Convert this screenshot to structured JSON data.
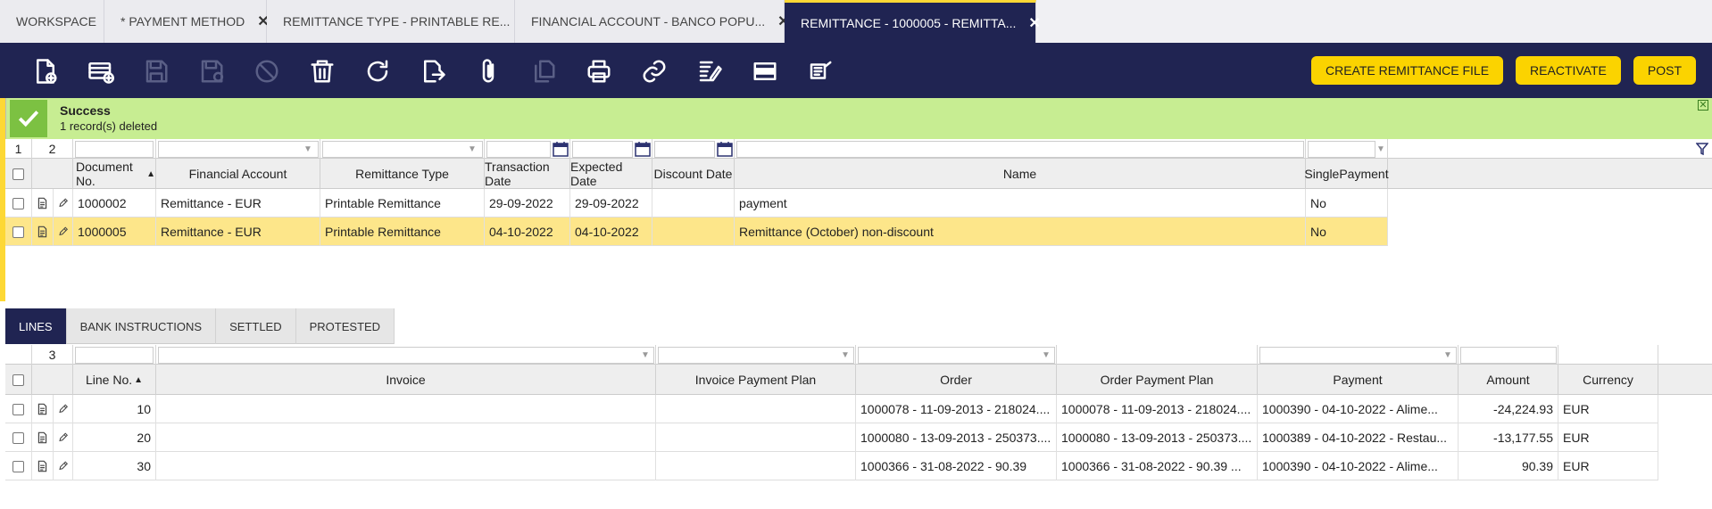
{
  "tabs": [
    {
      "label": "WORKSPACE",
      "closable": false
    },
    {
      "label": "* PAYMENT METHOD",
      "closable": true
    },
    {
      "label": "REMITTANCE TYPE - PRINTABLE RE...",
      "closable": true
    },
    {
      "label": "FINANCIAL ACCOUNT - BANCO POPU...",
      "closable": true
    },
    {
      "label": "REMITTANCE - 1000005 - REMITTA...",
      "closable": true
    }
  ],
  "toolbar": {
    "icons": [
      "new-document-icon",
      "new-row-icon",
      "save-icon",
      "save-close-icon",
      "undo-icon",
      "delete-icon",
      "refresh-icon",
      "export-icon",
      "attachment-icon",
      "copy-icon",
      "print-icon",
      "link-icon",
      "audit-icon",
      "toggle-view-icon",
      "notes-icon"
    ],
    "create_file": "CREATE REMITTANCE FILE",
    "reactivate": "REACTIVATE",
    "post": "POST"
  },
  "message": {
    "title": "Success",
    "text": "1 record(s) deleted"
  },
  "header_grid": {
    "selected_count": "1",
    "total_count": "2",
    "columns": [
      "Document No.",
      "Financial Account",
      "Remittance Type",
      "Transaction Date",
      "Expected Date",
      "Discount Date",
      "Name",
      "SinglePayment"
    ],
    "rows": [
      {
        "doc": "1000002",
        "account": "Remittance - EUR",
        "type": "Printable Remittance",
        "tdate": "29-09-2022",
        "edate": "29-09-2022",
        "ddate": "",
        "name": "payment",
        "single": "No"
      },
      {
        "doc": "1000005",
        "account": "Remittance - EUR",
        "type": "Printable Remittance",
        "tdate": "04-10-2022",
        "edate": "04-10-2022",
        "ddate": "",
        "name": "Remittance (October) non-discount",
        "single": "No"
      }
    ]
  },
  "subtabs": [
    "LINES",
    "BANK INSTRUCTIONS",
    "SETTLED",
    "PROTESTED"
  ],
  "lines_grid": {
    "count": "3",
    "columns": [
      "Line No.",
      "Invoice",
      "Invoice Payment Plan",
      "Order",
      "Order Payment Plan",
      "Payment",
      "Amount",
      "Currency"
    ],
    "rows": [
      {
        "line": "10",
        "invoice": "",
        "ipp": "",
        "order": "1000078 - 11-09-2013 - 218024....",
        "opp": "1000078 - 11-09-2013 - 218024....",
        "payment": "1000390 - 04-10-2022 - Alime...",
        "amount": "-24,224.93",
        "currency": "EUR"
      },
      {
        "line": "20",
        "invoice": "",
        "ipp": "",
        "order": "1000080 - 13-09-2013 - 250373....",
        "opp": "1000080 - 13-09-2013 - 250373....",
        "payment": "1000389 - 04-10-2022 - Restau...",
        "amount": "-13,177.55",
        "currency": "EUR"
      },
      {
        "line": "30",
        "invoice": "",
        "ipp": "",
        "order": "1000366 - 31-08-2022 - 90.39",
        "opp": "1000366 - 31-08-2022 - 90.39 ...",
        "payment": "1000390 - 04-10-2022 - Alime...",
        "amount": "90.39",
        "currency": "EUR"
      }
    ]
  },
  "colors": {
    "navy": "#202452",
    "yellow": "#fbd300",
    "success": "#c7ed92",
    "selected_row": "#fde68a"
  }
}
